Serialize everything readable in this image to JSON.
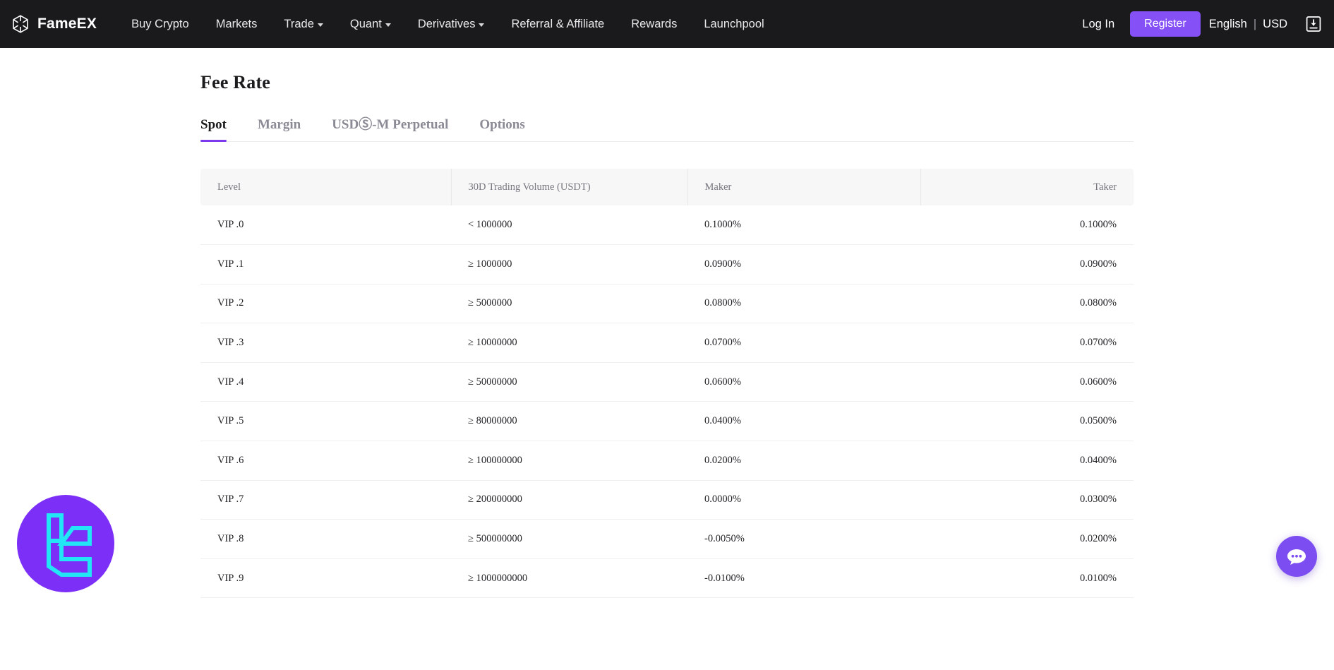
{
  "header": {
    "brand": "FameEX",
    "brand_icon": "fameex-logo-icon",
    "nav": [
      {
        "label": "Buy Crypto",
        "has_caret": false
      },
      {
        "label": "Markets",
        "has_caret": false
      },
      {
        "label": "Trade",
        "has_caret": true
      },
      {
        "label": "Quant",
        "has_caret": true
      },
      {
        "label": "Derivatives",
        "has_caret": true
      },
      {
        "label": "Referral & Affiliate",
        "has_caret": false
      },
      {
        "label": "Rewards",
        "has_caret": false
      },
      {
        "label": "Launchpool",
        "has_caret": false
      }
    ],
    "login": "Log In",
    "register": "Register",
    "language": "English",
    "separator": "|",
    "currency": "USD",
    "download_icon": "download-icon",
    "accent_color": "#8551f6",
    "background_color": "#1a1a1d"
  },
  "main": {
    "title": "Fee Rate",
    "tabs": [
      {
        "label": "Spot",
        "active": true
      },
      {
        "label": "Margin",
        "active": false
      },
      {
        "label": "USDⓈ-M Perpetual",
        "active": false
      },
      {
        "label": "Options",
        "active": false
      }
    ],
    "active_tab_underline_color": "#7c3aed",
    "table": {
      "columns": [
        "Level",
        "30D Trading Volume (USDT)",
        "Maker",
        "Taker"
      ],
      "rows": [
        {
          "level": "VIP .0",
          "volume": "< 1000000",
          "maker": "0.1000%",
          "taker": "0.1000%"
        },
        {
          "level": "VIP .1",
          "volume": "≥ 1000000",
          "maker": "0.0900%",
          "taker": "0.0900%"
        },
        {
          "level": "VIP .2",
          "volume": "≥ 5000000",
          "maker": "0.0800%",
          "taker": "0.0800%"
        },
        {
          "level": "VIP .3",
          "volume": "≥ 10000000",
          "maker": "0.0700%",
          "taker": "0.0700%"
        },
        {
          "level": "VIP .4",
          "volume": "≥ 50000000",
          "maker": "0.0600%",
          "taker": "0.0600%"
        },
        {
          "level": "VIP .5",
          "volume": "≥ 80000000",
          "maker": "0.0400%",
          "taker": "0.0500%"
        },
        {
          "level": "VIP .6",
          "volume": "≥ 100000000",
          "maker": "0.0200%",
          "taker": "0.0400%"
        },
        {
          "level": "VIP .7",
          "volume": "≥ 200000000",
          "maker": "0.0000%",
          "taker": "0.0300%"
        },
        {
          "level": "VIP .8",
          "volume": "≥ 500000000",
          "maker": "-0.0050%",
          "taker": "0.0200%"
        },
        {
          "level": "VIP .9",
          "volume": "≥ 1000000000",
          "maker": "-0.0100%",
          "taker": "0.0100%"
        }
      ]
    }
  },
  "widgets": {
    "coin_badge_icon": "lc-coin-logo-icon",
    "coin_badge_color": "#7b2ff7",
    "coin_badge_glyph_color": "#22e6f5",
    "chat_icon": "chat-bubble-icon",
    "chat_color": "#7c4df0"
  }
}
